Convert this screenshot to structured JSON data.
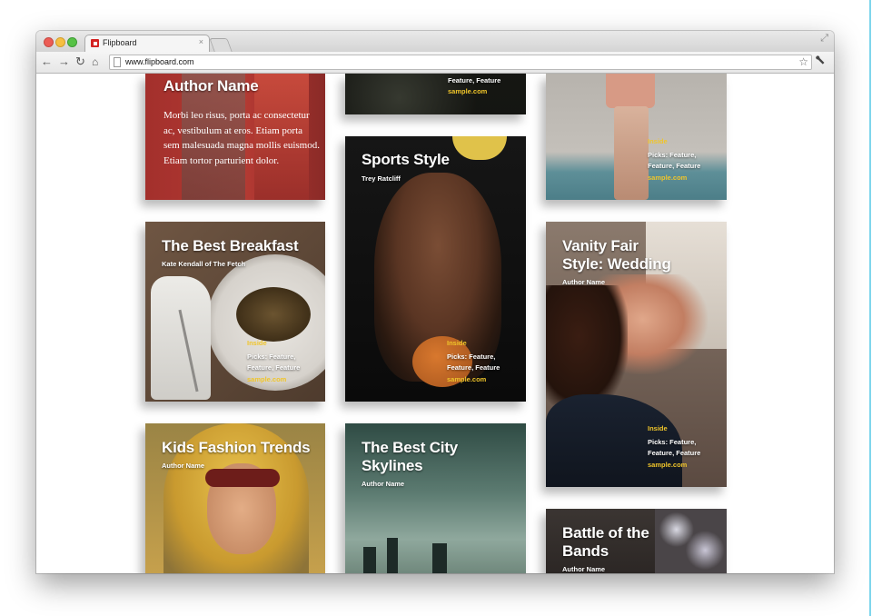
{
  "browser": {
    "tab_title": "Flipboard",
    "tab_close": "×",
    "fullscreen_icon": "⤢",
    "nav_icons": {
      "back": "←",
      "forward": "→",
      "reload": "↻",
      "home": "⌂"
    },
    "url": "www.flipboard.com",
    "star_icon": "☆",
    "wrench_icon": "🔧"
  },
  "cards": {
    "author_name": {
      "title": "Author Name",
      "body": "Morbi leo risus, porta ac consectetur ac, vestibulum at eros. Etiam porta sem malesuada magna mollis euismod. Etiam tortor parturient dolor."
    },
    "top_middle": {
      "picks": "Feature, Feature",
      "sample": "sample.com"
    },
    "top_right": {
      "inside": "Inside",
      "picks": "Picks: Feature, Feature, Feature",
      "sample": "sample.com"
    },
    "sports_style": {
      "title": "Sports Style",
      "author": "Trey Ratcliff",
      "inside": "Inside",
      "picks": "Picks: Feature, Feature, Feature",
      "sample": "sample.com"
    },
    "best_breakfast": {
      "title": "The Best Breakfast",
      "author": "Kate Kendall of The Fetch",
      "inside": "Inside",
      "picks": "Picks: Feature, Feature, Feature",
      "sample": "sample.com"
    },
    "vanity_fair": {
      "title": "Vanity Fair Style: Wedding",
      "author": "Author Name",
      "inside": "Inside",
      "picks": "Picks: Feature, Feature, Feature",
      "sample": "sample.com"
    },
    "kids_fashion": {
      "title": "Kids Fashion Trends",
      "author": "Author Name"
    },
    "city_skylines": {
      "title": "The Best City Skylines",
      "author": "Author Name"
    },
    "battle_bands": {
      "title": "Battle of the Bands",
      "author": "Author Name"
    }
  }
}
